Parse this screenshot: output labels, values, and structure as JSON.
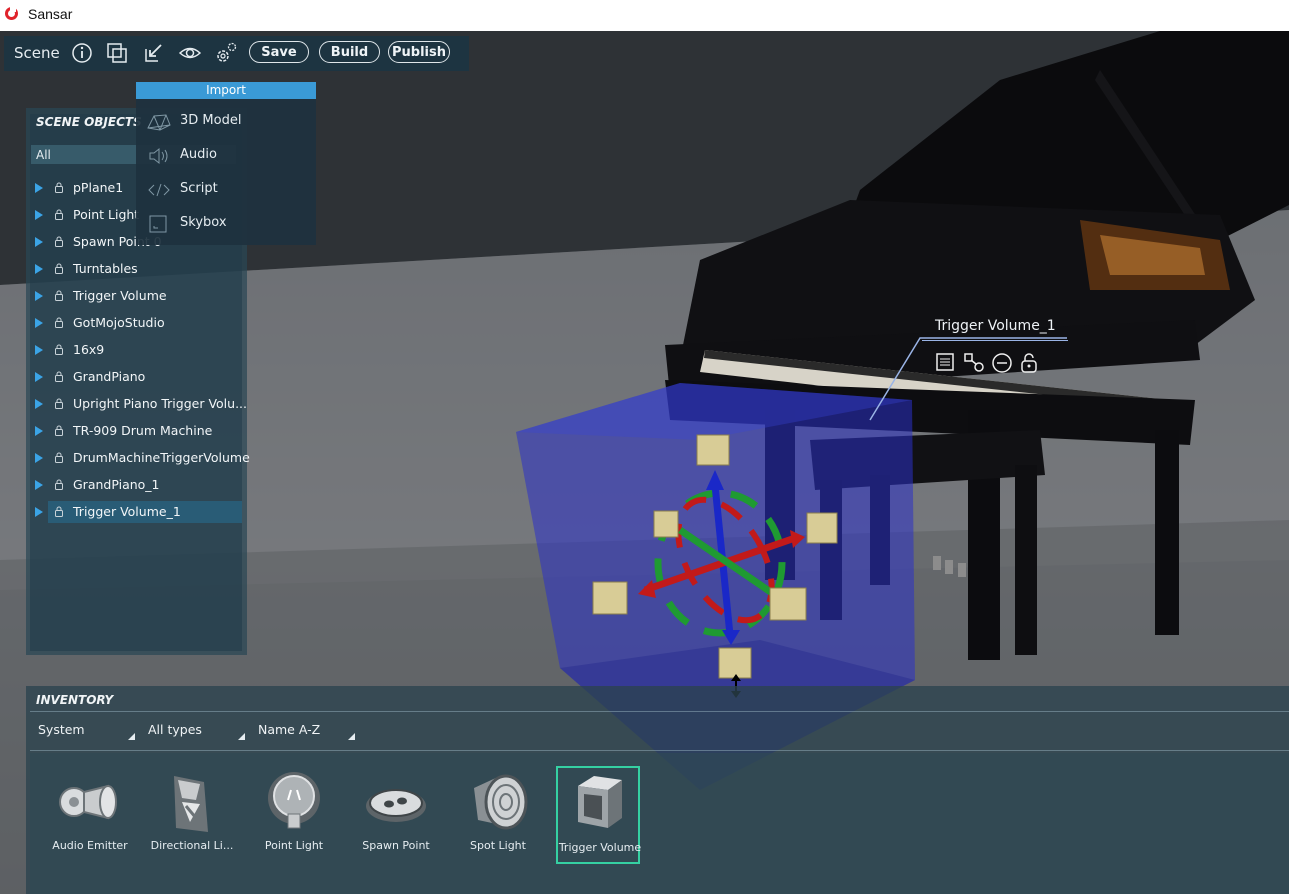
{
  "window": {
    "title": "Sansar"
  },
  "toolbar": {
    "scene_label": "Scene",
    "icons": [
      "info-icon",
      "duplicate-icon",
      "import-icon",
      "visibility-icon",
      "settings-icon"
    ],
    "save_label": "Save",
    "build_label": "Build",
    "publish_label": "Publish"
  },
  "import_menu": {
    "header": "Import",
    "items": [
      {
        "label": "3D Model",
        "icon": "mesh-icon"
      },
      {
        "label": "Audio",
        "icon": "audio-icon"
      },
      {
        "label": "Script",
        "icon": "script-icon"
      },
      {
        "label": "Skybox",
        "icon": "skybox-icon"
      }
    ]
  },
  "scene_objects": {
    "title": "SCENE OBJECTS",
    "filter_value": "All",
    "items": [
      {
        "label": "pPlane1"
      },
      {
        "label": "Point Light"
      },
      {
        "label": "Spawn Point 0"
      },
      {
        "label": "Turntables"
      },
      {
        "label": "Trigger Volume"
      },
      {
        "label": "GotMojoStudio"
      },
      {
        "label": "16x9"
      },
      {
        "label": "GrandPiano"
      },
      {
        "label": "Upright Piano Trigger Volu..."
      },
      {
        "label": "TR-909 Drum Machine"
      },
      {
        "label": "DrumMachineTriggerVolume"
      },
      {
        "label": "GrandPiano_1"
      },
      {
        "label": "Trigger Volume_1",
        "selected": true
      }
    ]
  },
  "viewport": {
    "selected_object_label": "Trigger Volume_1",
    "object_tools": [
      "properties-icon",
      "link-icon",
      "remove-icon",
      "unlock-icon"
    ]
  },
  "inventory": {
    "title": "INVENTORY",
    "filters": {
      "source": "System",
      "type": "All types",
      "sort": "Name A-Z"
    },
    "items": [
      {
        "label": "Audio Emitter",
        "icon": "speaker-icon"
      },
      {
        "label": "Directional Li...",
        "icon": "directional-light-icon"
      },
      {
        "label": "Point Light",
        "icon": "bulb-icon"
      },
      {
        "label": "Spawn Point",
        "icon": "footprints-icon"
      },
      {
        "label": "Spot Light",
        "icon": "spotlight-icon"
      },
      {
        "label": "Trigger Volume",
        "icon": "cube-icon",
        "selected": true
      }
    ]
  },
  "colors": {
    "accent": "#3a9ad6",
    "selection": "#35d0a2",
    "toolbar_bg": "#1c3442"
  }
}
